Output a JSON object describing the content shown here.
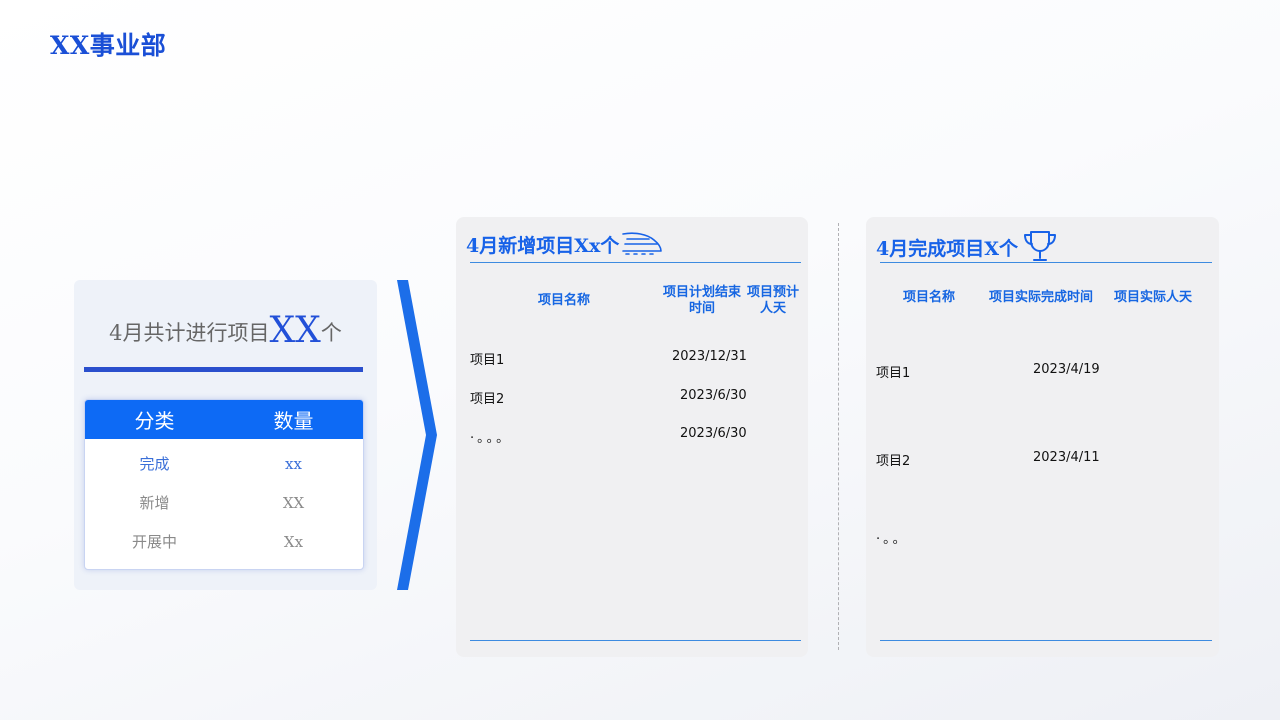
{
  "header": {
    "title": "XX事业部"
  },
  "summary": {
    "prefix": "4月共计进行项目",
    "count": "XX",
    "suffix": "个",
    "table": {
      "headers": [
        "分类",
        "数量"
      ],
      "rows": [
        {
          "category": "完成",
          "count": "xx"
        },
        {
          "category": "新增",
          "count": "XX"
        },
        {
          "category": "开展中",
          "count": "Xx"
        }
      ]
    }
  },
  "new_projects": {
    "title": "4月新增项目Xx个",
    "icon": "high-speed-train-icon",
    "columns": [
      "项目名称",
      "项目计划结束时间",
      "项目预计人天"
    ],
    "rows": [
      {
        "name": "项目1",
        "end_date": "2023/12/31"
      },
      {
        "name": "项目2",
        "end_date": "2023/6/30"
      },
      {
        "name": "·。。。",
        "end_date": "2023/6/30"
      }
    ]
  },
  "done_projects": {
    "title": "4月完成项目X个",
    "icon": "trophy-icon",
    "columns": [
      "项目名称",
      "项目实际完成时间",
      "项目实际人天"
    ],
    "rows": [
      {
        "name": "项目1",
        "done_date": "2023/4/19"
      },
      {
        "name": "项目2",
        "done_date": "2023/4/11"
      },
      {
        "name": "·。。",
        "done_date": ""
      }
    ]
  },
  "colors": {
    "accent": "#1762e8",
    "header_blue": "#0d6af5",
    "brand": "#1a4fd6"
  }
}
